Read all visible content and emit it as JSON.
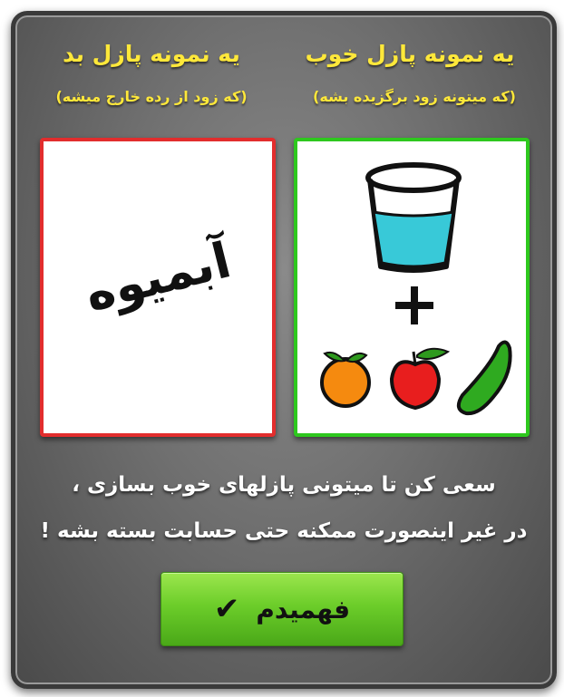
{
  "good": {
    "title": "یه نمونه پازل خوب",
    "subtitle": "(که میتونه زود برگزیده بشه)"
  },
  "bad": {
    "title": "یه نمونه پازل بد",
    "subtitle": "(که زود از رده خارج میشه)",
    "word": "آبمیوه"
  },
  "message": {
    "line1": "سعی کن تا میتونی پازلهای خوب بسازی ،",
    "line2": "در غیر اینصورت ممکنه حتی حسابت بسته بشه !"
  },
  "button": {
    "label": "فهمیدم",
    "icon": "checkmark-icon",
    "icon_glyph": "✔"
  },
  "colors": {
    "title_yellow": "#ffe83a",
    "good_border": "#2ec81e",
    "bad_border": "#e22d2d",
    "button_green": "#6ccd2a"
  }
}
